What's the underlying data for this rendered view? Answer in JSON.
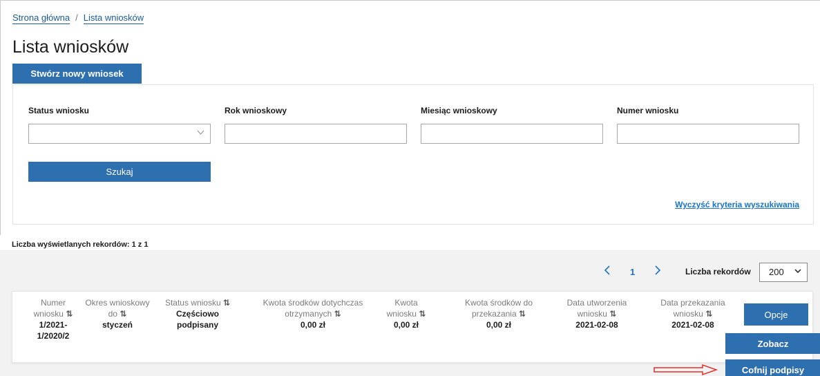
{
  "breadcrumb": {
    "home": "Strona główna",
    "separator": "/",
    "current": "Lista wniosków"
  },
  "page_title": "Lista wniosków",
  "new_request_button": "Stwórz nowy wniosek",
  "filters": {
    "status_label": "Status wniosku",
    "status_value": "",
    "year_label": "Rok wnioskowy",
    "year_value": "",
    "month_label": "Miesiąc wnioskowy",
    "month_value": "",
    "number_label": "Numer wniosku",
    "number_value": "",
    "search_button": "Szukaj",
    "clear_link": "Wyczyść kryteria wyszukiwania"
  },
  "records_count": "Liczba wyświetlanych rekordów: 1 z 1",
  "pager": {
    "prev": "<",
    "page": "1",
    "next": ">",
    "per_page_label": "Liczba rekordów",
    "per_page_value": "200"
  },
  "table": {
    "sort_icon": "⇅",
    "columns": [
      {
        "line1": "Numer",
        "line2": "wniosku",
        "value1": "1/2021-",
        "value2": "1/2020/2"
      },
      {
        "line1": "Okres wnioskowy",
        "line2": "do",
        "value1": "styczeń",
        "value2": ""
      },
      {
        "line1": "Status wniosku",
        "line2": "",
        "value1": "Częściowo",
        "value2": "podpisany"
      },
      {
        "line1": "Kwota środków dotychczas",
        "line2": "otrzymanych",
        "value1": "0,00 zł",
        "value2": ""
      },
      {
        "line1": "Kwota",
        "line2": "wniosku",
        "value1": "0,00 zł",
        "value2": ""
      },
      {
        "line1": "Kwota środków do",
        "line2": "przekazania",
        "value1": "0,00 zł",
        "value2": ""
      },
      {
        "line1": "Data utworzenia",
        "line2": "wniosku",
        "value1": "2021-02-08",
        "value2": ""
      },
      {
        "line1": "Data przekazania",
        "line2": "wniosku",
        "value1": "2021-02-08",
        "value2": ""
      }
    ],
    "options_button": "Opcje"
  },
  "options_menu": {
    "view": "Zobacz",
    "revoke_signatures": "Cofnij podpisy"
  },
  "colors": {
    "primary": "#2e6fb0",
    "link": "#1a73c9",
    "annotation_arrow": "#e0302a"
  }
}
